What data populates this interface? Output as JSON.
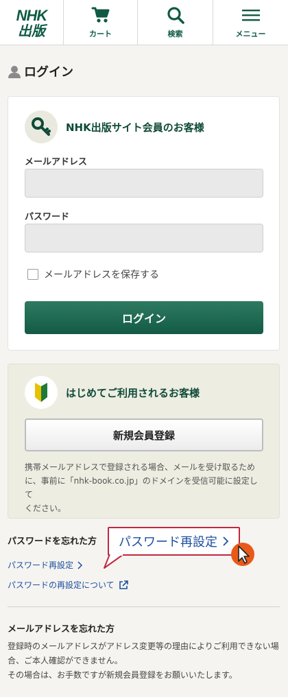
{
  "header": {
    "logo_line1": "NHK",
    "logo_line2": "出版",
    "cart_label": "カート",
    "search_label": "検索",
    "menu_label": "メニュー"
  },
  "page": {
    "title": "ログイン"
  },
  "login": {
    "title": "NHK出版サイト会員のお客様",
    "email_label": "メールアドレス",
    "email_value": "",
    "password_label": "パスワード",
    "password_value": "",
    "remember_label": "メールアドレスを保存する",
    "remember_checked": false,
    "submit_label": "ログイン"
  },
  "register": {
    "title": "はじめてご利用されるお客様",
    "button_label": "新規会員登録",
    "note_lines": [
      "携帯メールアドレスで登録される場合、メールを受け取るため",
      "に、事前に「nhk-book.co.jp」のドメインを受信可能に設定して",
      "ください。"
    ]
  },
  "forgot_password": {
    "title": "パスワードを忘れた方",
    "reset_link": "パスワード再設定",
    "about_link": "パスワードの再設定について",
    "callout_label": "パスワード再設定"
  },
  "forgot_email": {
    "title": "メールアドレスを忘れた方",
    "lines": [
      "登録時のメールアドレスがアドレス変更等の理由によりご利用できない場",
      "合、ご本人確認ができません。",
      "その場合は、お手数ですが新規会員登録をお願いいたします。"
    ]
  },
  "colors": {
    "brand_green": "#0f5a43",
    "link_blue": "#1d4fa1",
    "callout_red": "#c0283e",
    "cursor_orange": "#e8591a"
  },
  "icons": {
    "cart": "cart-icon",
    "search": "search-icon",
    "menu": "hamburger-menu-icon",
    "user": "user-icon",
    "key": "key-icon",
    "beginner": "beginner-mark-icon",
    "chevron": "chevron-right-icon",
    "external": "external-link-icon",
    "cursor": "mouse-cursor-icon"
  }
}
